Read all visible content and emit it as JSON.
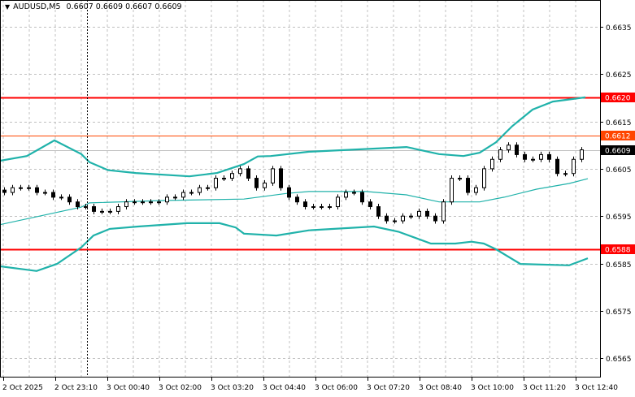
{
  "header": {
    "symbol": "AUDUSD,M5",
    "quote_open": "0.6607",
    "quote_high": "0.6609",
    "quote_low": "0.6607",
    "quote_close": "0.6609",
    "menu_icon": "triangle-down-icon"
  },
  "colors": {
    "background": "#ffffff",
    "grid": "#c0c0c0",
    "bands": "#20b2aa",
    "candle": "#000000",
    "level_red": "#ff0000",
    "level_orange": "#ff4500",
    "last_price_line": "#c0c0c0",
    "last_price_box": "#000000"
  },
  "chart_data": {
    "type": "candlestick",
    "title": "AUDUSD,M5",
    "ylim": [
      0.65565,
      0.664
    ],
    "y_ticks": [
      "0.6635",
      "0.6625",
      "0.6615",
      "0.6605",
      "0.6595",
      "0.6585",
      "0.6575",
      "0.6565"
    ],
    "x_ticks": [
      "2 Oct 2025",
      "2 Oct 23:10",
      "3 Oct 00:40",
      "3 Oct 02:00",
      "3 Oct 03:20",
      "3 Oct 04:40",
      "3 Oct 06:00",
      "3 Oct 07:20",
      "3 Oct 08:40",
      "3 Oct 10:00",
      "3 Oct 11:20",
      "3 Oct 12:40"
    ],
    "closes": [
      0.66,
      0.6601,
      0.6601,
      0.6601,
      0.66,
      0.66,
      0.6599,
      0.6599,
      0.6598,
      0.6597,
      0.6597,
      0.6596,
      0.6596,
      0.6596,
      0.6597,
      0.6598,
      0.6598,
      0.6598,
      0.6598,
      0.6598,
      0.6599,
      0.6599,
      0.66,
      0.66,
      0.6601,
      0.6601,
      0.6603,
      0.6603,
      0.6604,
      0.6605,
      0.6603,
      0.6601,
      0.6602,
      0.6605,
      0.6601,
      0.6599,
      0.6598,
      0.6597,
      0.6597,
      0.6597,
      0.6597,
      0.6599,
      0.66,
      0.66,
      0.6598,
      0.6597,
      0.6595,
      0.6594,
      0.6594,
      0.6595,
      0.6595,
      0.6596,
      0.6595,
      0.6594,
      0.6598,
      0.6603,
      0.6603,
      0.66,
      0.6601,
      0.6605,
      0.6607,
      0.6609,
      0.661,
      0.6608,
      0.6607,
      0.6607,
      0.6608,
      0.6607,
      0.6604,
      0.6604,
      0.6607,
      0.6609
    ],
    "bollinger": {
      "upper": [
        [
          -0.5,
          0.66067
        ],
        [
          2.8,
          0.66077
        ],
        [
          6.2,
          0.6611
        ],
        [
          9.5,
          0.66081
        ],
        [
          10.5,
          0.66064
        ],
        [
          12.8,
          0.66047
        ],
        [
          16.2,
          0.66041
        ],
        [
          22.8,
          0.66034
        ],
        [
          26.2,
          0.66041
        ],
        [
          29.5,
          0.6606
        ],
        [
          31.2,
          0.66076
        ],
        [
          32.8,
          0.66077
        ],
        [
          37.5,
          0.66086
        ],
        [
          49.5,
          0.66096
        ],
        [
          53.5,
          0.66081
        ],
        [
          56.5,
          0.66077
        ],
        [
          58.5,
          0.66084
        ],
        [
          60.5,
          0.66106
        ],
        [
          62.5,
          0.6614
        ],
        [
          65,
          0.66175
        ],
        [
          67.5,
          0.66192
        ],
        [
          71.5,
          0.66201
        ]
      ],
      "middle": [
        [
          -0.5,
          0.65932
        ],
        [
          9.5,
          0.65969
        ],
        [
          10.5,
          0.65978
        ],
        [
          19.5,
          0.65983
        ],
        [
          29.5,
          0.65986
        ],
        [
          34.8,
          0.65998
        ],
        [
          37.5,
          0.66002
        ],
        [
          44.5,
          0.66002
        ],
        [
          49.5,
          0.65995
        ],
        [
          53.5,
          0.6598
        ],
        [
          58.5,
          0.6598
        ],
        [
          61.5,
          0.6599
        ],
        [
          65.5,
          0.66007
        ],
        [
          69.5,
          0.66019
        ],
        [
          71.8,
          0.66029
        ]
      ],
      "lower": [
        [
          -0.5,
          0.65844
        ],
        [
          4,
          0.65834
        ],
        [
          6.5,
          0.65849
        ],
        [
          9.5,
          0.65884
        ],
        [
          11,
          0.65909
        ],
        [
          13,
          0.65923
        ],
        [
          16.5,
          0.65928
        ],
        [
          22.5,
          0.65935
        ],
        [
          26.5,
          0.65935
        ],
        [
          28.5,
          0.65926
        ],
        [
          29.5,
          0.65913
        ],
        [
          33.5,
          0.65909
        ],
        [
          37.5,
          0.6592
        ],
        [
          45.5,
          0.65928
        ],
        [
          48.5,
          0.65917
        ],
        [
          52.5,
          0.65892
        ],
        [
          55.5,
          0.65892
        ],
        [
          57.5,
          0.65896
        ],
        [
          59,
          0.65892
        ],
        [
          60.5,
          0.6588
        ],
        [
          63.5,
          0.65849
        ],
        [
          69.5,
          0.65846
        ],
        [
          71.8,
          0.65861
        ]
      ]
    },
    "levels": [
      {
        "price": 0.662,
        "label": "0.6620",
        "color": "#ff0000",
        "width": 2
      },
      {
        "price": 0.6612,
        "label": "0.6612",
        "color": "#ff4500",
        "width": 1
      },
      {
        "price": 0.6588,
        "label": "0.6588",
        "color": "#ff0000",
        "width": 2
      }
    ],
    "last_price": {
      "price": 0.6609,
      "label": "0.6609"
    },
    "crosshair_bar": 10.2
  }
}
